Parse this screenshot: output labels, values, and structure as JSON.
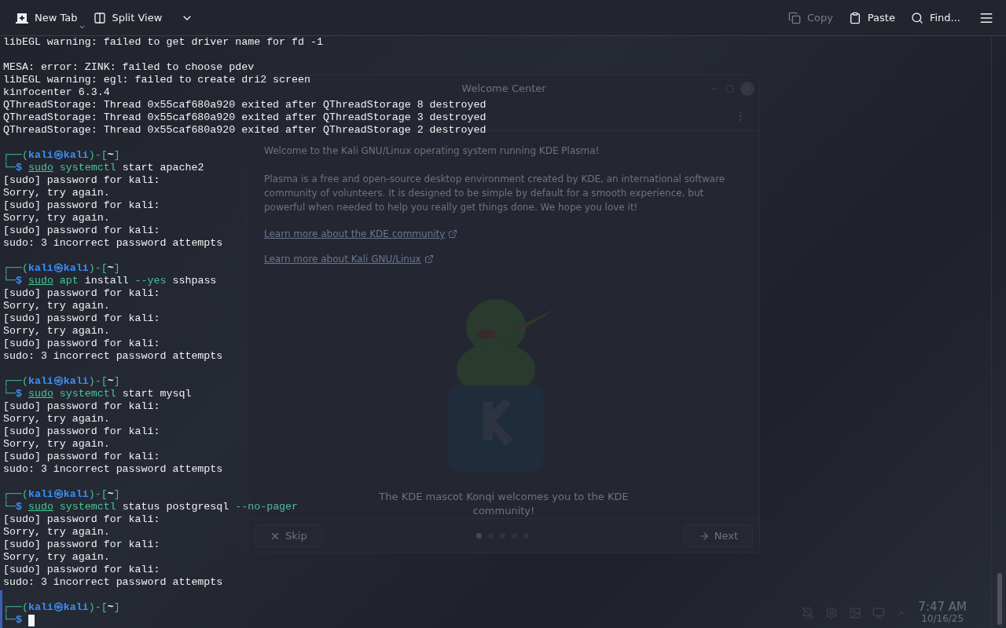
{
  "toolbar": {
    "left": [
      {
        "label": "New Tab",
        "kind": "new-tab",
        "disabled": false
      },
      {
        "label": "Split View",
        "kind": "split-view",
        "disabled": false
      }
    ],
    "right": [
      {
        "label": "Copy",
        "kind": "copy",
        "disabled": true
      },
      {
        "label": "Paste",
        "kind": "paste",
        "disabled": false
      },
      {
        "label": "Find...",
        "kind": "find",
        "disabled": false
      }
    ]
  },
  "welcome_window": {
    "title": "Welcome Center",
    "paragraphs": [
      "Welcome to the Kali GNU/Linux operating system running KDE Plasma!",
      "Plasma is a free and open-source desktop environment created by KDE, an international software community of volunteers. It is designed to be simple by default for a smooth experience, but powerful when needed to help you really get things done. We hope you love it!"
    ],
    "links": [
      "Learn more about the KDE community",
      "Learn more about Kali GNU/Linux"
    ],
    "caption": "The KDE mascot Konqi welcomes you to the KDE community!",
    "pages": [
      {
        "selected": true
      },
      {
        "selected": false
      },
      {
        "selected": false
      },
      {
        "selected": false
      },
      {
        "selected": false
      }
    ],
    "buttons": [
      {
        "label": "Skip",
        "kind": "skip"
      },
      {
        "label": "Next",
        "kind": "next"
      }
    ]
  },
  "clock": {
    "time": "7:47 AM",
    "date": "10/16/25"
  },
  "terminal": {
    "lines": [
      {
        "kind": "output",
        "segments": [
          {
            "text": "libEGL warning: failed to get driver name for fd -1",
            "kind": "plain"
          }
        ]
      },
      {
        "kind": "blank"
      },
      {
        "kind": "output",
        "segments": [
          {
            "text": "MESA: error: ZINK: failed to choose pdev",
            "kind": "plain"
          }
        ]
      },
      {
        "kind": "output",
        "segments": [
          {
            "text": "libEGL warning: egl: failed to create dri2 screen",
            "kind": "plain"
          }
        ]
      },
      {
        "kind": "output",
        "segments": [
          {
            "text": "kinfocenter 6.3.4",
            "kind": "plain"
          }
        ]
      },
      {
        "kind": "output",
        "segments": [
          {
            "text": "QThreadStorage: Thread 0x55caf680a920 exited after QThreadStorage 8 destroyed",
            "kind": "plain"
          }
        ]
      },
      {
        "kind": "output",
        "segments": [
          {
            "text": "QThreadStorage: Thread 0x55caf680a920 exited after QThreadStorage 3 destroyed",
            "kind": "plain"
          }
        ]
      },
      {
        "kind": "output",
        "segments": [
          {
            "text": "QThreadStorage: Thread 0x55caf680a920 exited after QThreadStorage 2 destroyed",
            "kind": "plain"
          }
        ]
      },
      {
        "kind": "blank"
      },
      {
        "kind": "prompt",
        "segments": [
          {
            "text": "┌──(",
            "kind": "frame"
          },
          {
            "text": "kali㉿kali",
            "kind": "user"
          },
          {
            "text": ")-[",
            "kind": "frame"
          },
          {
            "text": "~",
            "kind": "dir"
          },
          {
            "text": "]",
            "kind": "frame"
          }
        ]
      },
      {
        "kind": "command",
        "segments": [
          {
            "text": "└─",
            "kind": "frame"
          },
          {
            "text": "$ ",
            "kind": "user"
          },
          {
            "text": "sudo",
            "kind": "sudo"
          },
          {
            "text": " systemctl",
            "kind": "cmd"
          },
          {
            "text": " start apache2",
            "kind": "plain"
          }
        ]
      },
      {
        "kind": "output",
        "segments": [
          {
            "text": "[sudo] password for kali:",
            "kind": "plain"
          }
        ]
      },
      {
        "kind": "output",
        "segments": [
          {
            "text": "Sorry, try again.",
            "kind": "plain"
          }
        ]
      },
      {
        "kind": "output",
        "segments": [
          {
            "text": "[sudo] password for kali:",
            "kind": "plain"
          }
        ]
      },
      {
        "kind": "output",
        "segments": [
          {
            "text": "Sorry, try again.",
            "kind": "plain"
          }
        ]
      },
      {
        "kind": "output",
        "segments": [
          {
            "text": "[sudo] password for kali:",
            "kind": "plain"
          }
        ]
      },
      {
        "kind": "output",
        "segments": [
          {
            "text": "sudo: 3 incorrect password attempts",
            "kind": "plain"
          }
        ]
      },
      {
        "kind": "blank"
      },
      {
        "kind": "prompt",
        "segments": [
          {
            "text": "┌──(",
            "kind": "frame"
          },
          {
            "text": "kali㉿kali",
            "kind": "user"
          },
          {
            "text": ")-[",
            "kind": "frame"
          },
          {
            "text": "~",
            "kind": "dir"
          },
          {
            "text": "]",
            "kind": "frame"
          }
        ]
      },
      {
        "kind": "command",
        "segments": [
          {
            "text": "└─",
            "kind": "frame"
          },
          {
            "text": "$ ",
            "kind": "user"
          },
          {
            "text": "sudo",
            "kind": "sudo"
          },
          {
            "text": " apt",
            "kind": "cmd"
          },
          {
            "text": " install ",
            "kind": "plain"
          },
          {
            "text": "--yes",
            "kind": "option"
          },
          {
            "text": " sshpass",
            "kind": "plain"
          }
        ]
      },
      {
        "kind": "output",
        "segments": [
          {
            "text": "[sudo] password for kali:",
            "kind": "plain"
          }
        ]
      },
      {
        "kind": "output",
        "segments": [
          {
            "text": "Sorry, try again.",
            "kind": "plain"
          }
        ]
      },
      {
        "kind": "output",
        "segments": [
          {
            "text": "[sudo] password for kali:",
            "kind": "plain"
          }
        ]
      },
      {
        "kind": "output",
        "segments": [
          {
            "text": "Sorry, try again.",
            "kind": "plain"
          }
        ]
      },
      {
        "kind": "output",
        "segments": [
          {
            "text": "[sudo] password for kali:",
            "kind": "plain"
          }
        ]
      },
      {
        "kind": "output",
        "segments": [
          {
            "text": "sudo: 3 incorrect password attempts",
            "kind": "plain"
          }
        ]
      },
      {
        "kind": "blank"
      },
      {
        "kind": "prompt",
        "segments": [
          {
            "text": "┌──(",
            "kind": "frame"
          },
          {
            "text": "kali㉿kali",
            "kind": "user"
          },
          {
            "text": ")-[",
            "kind": "frame"
          },
          {
            "text": "~",
            "kind": "dir"
          },
          {
            "text": "]",
            "kind": "frame"
          }
        ]
      },
      {
        "kind": "command",
        "segments": [
          {
            "text": "└─",
            "kind": "frame"
          },
          {
            "text": "$ ",
            "kind": "user"
          },
          {
            "text": "sudo",
            "kind": "sudo"
          },
          {
            "text": " systemctl",
            "kind": "cmd"
          },
          {
            "text": " start mysql",
            "kind": "plain"
          }
        ]
      },
      {
        "kind": "output",
        "segments": [
          {
            "text": "[sudo] password for kali:",
            "kind": "plain"
          }
        ]
      },
      {
        "kind": "output",
        "segments": [
          {
            "text": "Sorry, try again.",
            "kind": "plain"
          }
        ]
      },
      {
        "kind": "output",
        "segments": [
          {
            "text": "[sudo] password for kali:",
            "kind": "plain"
          }
        ]
      },
      {
        "kind": "output",
        "segments": [
          {
            "text": "Sorry, try again.",
            "kind": "plain"
          }
        ]
      },
      {
        "kind": "output",
        "segments": [
          {
            "text": "[sudo] password for kali:",
            "kind": "plain"
          }
        ]
      },
      {
        "kind": "output",
        "segments": [
          {
            "text": "sudo: 3 incorrect password attempts",
            "kind": "plain"
          }
        ]
      },
      {
        "kind": "blank"
      },
      {
        "kind": "prompt",
        "segments": [
          {
            "text": "┌──(",
            "kind": "frame"
          },
          {
            "text": "kali㉿kali",
            "kind": "user"
          },
          {
            "text": ")-[",
            "kind": "frame"
          },
          {
            "text": "~",
            "kind": "dir"
          },
          {
            "text": "]",
            "kind": "frame"
          }
        ]
      },
      {
        "kind": "command",
        "segments": [
          {
            "text": "└─",
            "kind": "frame"
          },
          {
            "text": "$ ",
            "kind": "user"
          },
          {
            "text": "sudo",
            "kind": "sudo"
          },
          {
            "text": " systemctl",
            "kind": "cmd"
          },
          {
            "text": " status postgresql ",
            "kind": "plain"
          },
          {
            "text": "--no-pager",
            "kind": "option"
          }
        ]
      },
      {
        "kind": "output",
        "segments": [
          {
            "text": "[sudo] password for kali:",
            "kind": "plain"
          }
        ]
      },
      {
        "kind": "output",
        "segments": [
          {
            "text": "Sorry, try again.",
            "kind": "plain"
          }
        ]
      },
      {
        "kind": "output",
        "segments": [
          {
            "text": "[sudo] password for kali:",
            "kind": "plain"
          }
        ]
      },
      {
        "kind": "output",
        "segments": [
          {
            "text": "Sorry, try again.",
            "kind": "plain"
          }
        ]
      },
      {
        "kind": "output",
        "segments": [
          {
            "text": "[sudo] password for kali:",
            "kind": "plain"
          }
        ]
      },
      {
        "kind": "output",
        "segments": [
          {
            "text": "sudo: 3 incorrect password attempts",
            "kind": "plain"
          }
        ]
      },
      {
        "kind": "blank"
      },
      {
        "kind": "prompt",
        "segments": [
          {
            "text": "┌──(",
            "kind": "frame"
          },
          {
            "text": "kali㉿kali",
            "kind": "user"
          },
          {
            "text": ")-[",
            "kind": "frame"
          },
          {
            "text": "~",
            "kind": "dir"
          },
          {
            "text": "]",
            "kind": "frame"
          }
        ]
      },
      {
        "kind": "input",
        "segments": [
          {
            "text": "└─",
            "kind": "frame"
          },
          {
            "text": "$",
            "kind": "user"
          }
        ]
      }
    ]
  }
}
